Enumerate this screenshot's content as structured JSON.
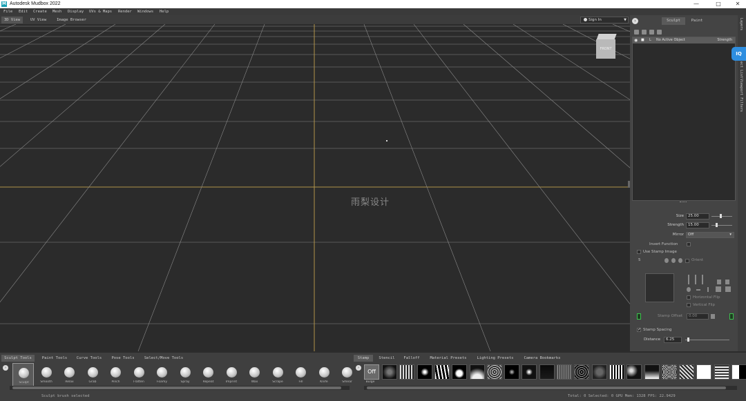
{
  "app": {
    "title": "Autodesk Mudbox 2022",
    "logo_letter": "M",
    "window_controls": [
      "—",
      "□",
      "✕"
    ]
  },
  "menu": [
    "File",
    "Edit",
    "Create",
    "Mesh",
    "Display",
    "UVs & Maps",
    "Render",
    "Windows",
    "Help"
  ],
  "view_tabs": [
    "3D View",
    "UV View",
    "Image Browser"
  ],
  "sign_in": "Sign In",
  "viewport": {
    "watermark": "雨梨设计",
    "viewcube_label": "FRONT"
  },
  "right_panel": {
    "tabs": [
      "Sculpt",
      "Paint"
    ],
    "layer_row": {
      "name": "L",
      "value": "No Active Object",
      "strength": "Strength"
    },
    "properties": {
      "size_label": "Size",
      "size_value": "25.00",
      "strength_label": "Strength",
      "strength_value": "15.00",
      "mirror_label": "Mirror",
      "mirror_value": "Off",
      "invert_function": "Invert Function",
      "use_stamp_image": "Use Stamp Image",
      "stamp_num": "5",
      "orient": "Orient",
      "horizontal_flip": "Horizontal Flip",
      "vertical_flip": "Vertical Flip",
      "stamp_offset_label": "Stamp Offset",
      "stamp_offset_value": "0.00",
      "stamp_spacing": "Stamp Spacing",
      "distance_label": "Distance",
      "distance_value": "6.25"
    },
    "side_tabs": [
      "Layers",
      "Object List",
      "Viewport Filters"
    ],
    "side_badge": "IQ"
  },
  "bottom": {
    "tool_tabs": [
      "Sculpt Tools",
      "Paint Tools",
      "Curve Tools",
      "Pose Tools",
      "Select/Move Tools"
    ],
    "tools": [
      "Sculpt",
      "Smooth",
      "Relax",
      "Grab",
      "Pinch",
      "Flatten",
      "Foamy",
      "Spray",
      "Repeat",
      "Imprint",
      "Wax",
      "Scrape",
      "Fill",
      "Knife",
      "Smear",
      "Bulge"
    ],
    "stamp_tabs": [
      "Stamp",
      "Stencil",
      "Falloff",
      "Material Presets",
      "Lighting Presets",
      "Camera Bookmarks"
    ],
    "stamp_off_label": "Off",
    "status_left": "Sculpt brush selected",
    "status_right": "Total: 0  Selected: 0  GPU Mem: 1328  FPS: 22.9429"
  }
}
